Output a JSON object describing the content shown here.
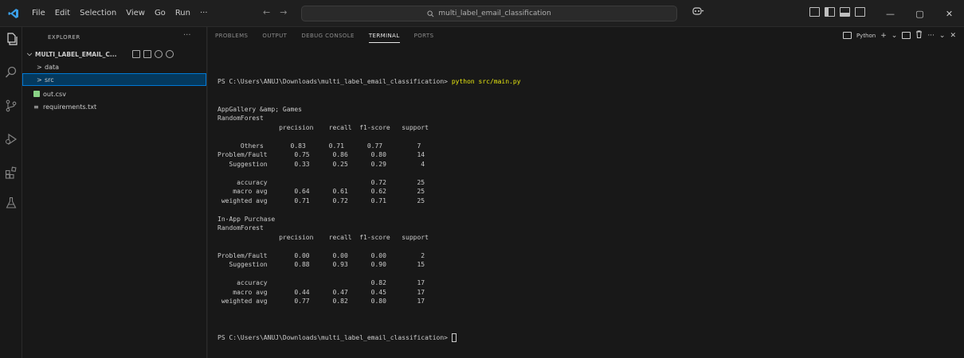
{
  "menu": [
    "File",
    "Edit",
    "Selection",
    "View",
    "Go",
    "Run",
    "···"
  ],
  "nav": {
    "back": "←",
    "forward": "→"
  },
  "search": {
    "text": "multi_label_email_classification"
  },
  "sidebar": {
    "header": "EXPLORER",
    "more": "···",
    "root": "MULTI_LABEL_EMAIL_C...",
    "items": [
      {
        "label": "data",
        "chevron": ">"
      },
      {
        "label": "src",
        "chevron": ">"
      },
      {
        "label": "out.csv"
      },
      {
        "label": "requirements.txt",
        "icon": "≡"
      }
    ]
  },
  "panel": {
    "tabs": [
      "PROBLEMS",
      "OUTPUT",
      "DEBUG CONSOLE",
      "TERMINAL",
      "PORTS"
    ],
    "active_tab": "TERMINAL",
    "shell_label": "Python",
    "actions": {
      "add": "+",
      "dropdown": "⌄",
      "more": "···",
      "collapse": "⌄",
      "close": "✕"
    }
  },
  "terminal": {
    "prompt": "PS C:\\Users\\ANUJ\\Downloads\\multi_label_email_classification> ",
    "command": "python src/main.py",
    "lines": [
      "AppGallery &amp; Games",
      "RandomForest",
      "                precision    recall  f1-score   support",
      "",
      "      Others       0.83      0.71      0.77         7",
      "Problem/Fault       0.75      0.86      0.80        14",
      "   Suggestion       0.33      0.25      0.29         4",
      "",
      "     accuracy                           0.72        25",
      "    macro avg       0.64      0.61      0.62        25",
      " weighted avg       0.71      0.72      0.71        25",
      "",
      "In-App Purchase",
      "RandomForest",
      "                precision    recall  f1-score   support",
      "",
      "Problem/Fault       0.00      0.00      0.00         2",
      "   Suggestion       0.88      0.93      0.90        15",
      "",
      "     accuracy                           0.82        17",
      "    macro avg       0.44      0.47      0.45        17",
      " weighted avg       0.77      0.82      0.80        17",
      ""
    ],
    "final_prompt": "PS C:\\Users\\ANUJ\\Downloads\\multi_label_email_classification> "
  },
  "colors": {
    "accent": "#0078d4",
    "selection": "#04395e",
    "command": "#e5e510",
    "csv": "#89d185"
  }
}
